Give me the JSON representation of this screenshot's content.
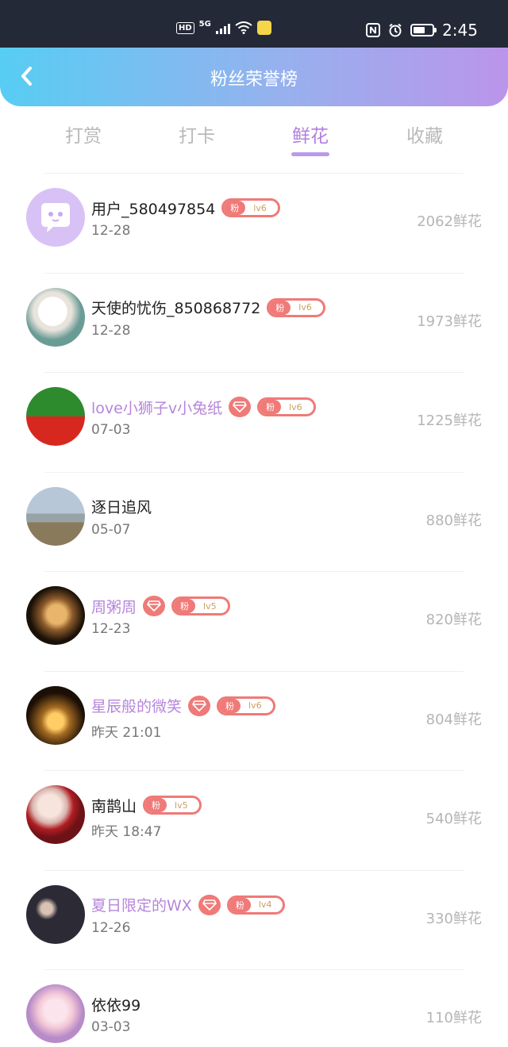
{
  "status_bar": {
    "left_icons": [
      "hd-icon",
      "5g-signal-icon",
      "wifi-icon",
      "app-notification-icon"
    ],
    "hd_label": "HD",
    "network_label": "5G",
    "right_icons": [
      "nfc-icon",
      "alarm-icon",
      "battery-icon"
    ],
    "time": "2:45"
  },
  "header": {
    "title": "粉丝荣誉榜",
    "back_icon": "chevron-left-icon",
    "gradient_colors": [
      "#57cdf3",
      "#bb95ea"
    ]
  },
  "tabs": {
    "items": [
      {
        "label": "打赏",
        "active": false
      },
      {
        "label": "打卡",
        "active": false
      },
      {
        "label": "鲜花",
        "active": true
      },
      {
        "label": "收藏",
        "active": false
      }
    ],
    "active_color": "#b27fde"
  },
  "badge": {
    "fen_label": "粉",
    "color": "#ef7a78"
  },
  "fans": [
    {
      "name": "用户_580497854",
      "vip": false,
      "level": "lv6",
      "date": "12-28",
      "count": "2062鲜花",
      "avatar": "chat-bubble-avatar"
    },
    {
      "name": "天使的忧伤_850868772",
      "vip": false,
      "level": "lv6",
      "date": "12-28",
      "count": "1973鲜花",
      "avatar": "flower-photo-avatar"
    },
    {
      "name": "love小狮子v小兔纸",
      "vip": true,
      "level": "lv6",
      "date": "07-03",
      "count": "1225鲜花",
      "avatar": "green-red-avatar"
    },
    {
      "name": "逐日追风",
      "vip": false,
      "level": "",
      "date": "05-07",
      "count": "880鲜花",
      "avatar": "horse-landscape-avatar"
    },
    {
      "name": "周粥周",
      "vip": true,
      "level": "lv5",
      "date": "12-23",
      "count": "820鲜花",
      "avatar": "girl-portrait-avatar"
    },
    {
      "name": "星辰般的微笑",
      "vip": true,
      "level": "lv6",
      "date": "昨天 21:01",
      "count": "804鲜花",
      "avatar": "candle-lights-avatar"
    },
    {
      "name": "南鹊山",
      "vip": false,
      "level": "lv5",
      "date": "昨天 18:47",
      "count": "540鲜花",
      "avatar": "girl-red-cloak-avatar"
    },
    {
      "name": "夏日限定的WX",
      "vip": true,
      "level": "lv4",
      "date": "12-26",
      "count": "330鲜花",
      "avatar": "two-men-avatar"
    },
    {
      "name": "依依99",
      "vip": false,
      "level": "",
      "date": "03-03",
      "count": "110鲜花",
      "avatar": "anime-girl-avatar"
    }
  ]
}
